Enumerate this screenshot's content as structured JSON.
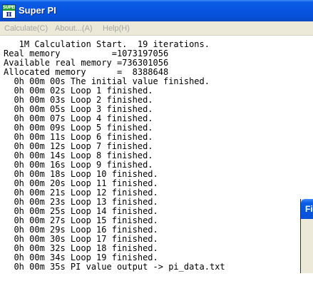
{
  "window": {
    "title": "Super PI",
    "icon_top_text": "SUPER",
    "icon_glyph": "π"
  },
  "menu": {
    "items": [
      "Calculate(C)",
      "About...(A)",
      "Help(H)"
    ],
    "state": "disabled"
  },
  "console": {
    "lines": [
      "   1M Calculation Start.  19 iterations.",
      "Real memory          =1073197056",
      "Available real memory =736301056",
      "Allocated memory      =  8388648",
      "  0h 00m 00s The initial value finished.",
      "  0h 00m 02s Loop 1 finished.",
      "  0h 00m 03s Loop 2 finished.",
      "  0h 00m 05s Loop 3 finished.",
      "  0h 00m 07s Loop 4 finished.",
      "  0h 00m 09s Loop 5 finished.",
      "  0h 00m 11s Loop 6 finished.",
      "  0h 00m 12s Loop 7 finished.",
      "  0h 00m 14s Loop 8 finished.",
      "  0h 00m 16s Loop 9 finished.",
      "  0h 00m 18s Loop 10 finished.",
      "  0h 00m 20s Loop 11 finished.",
      "  0h 00m 21s Loop 12 finished.",
      "  0h 00m 23s Loop 13 finished.",
      "  0h 00m 25s Loop 14 finished.",
      "  0h 00m 27s Loop 15 finished.",
      "  0h 00m 29s Loop 16 finished.",
      "  0h 00m 30s Loop 17 finished.",
      "  0h 00m 32s Loop 18 finished.",
      "  0h 00m 34s Loop 19 finished.",
      "  0h 00m 35s PI value output -> pi_data.txt"
    ]
  },
  "overlapping_window": {
    "title_fragment": "Fi"
  },
  "colors": {
    "titlebar": "#0755e0",
    "menubar": "#ece9d8",
    "menu_disabled_text": "#a7a6a0",
    "console_bg": "#ffffff",
    "console_text": "#000000"
  }
}
